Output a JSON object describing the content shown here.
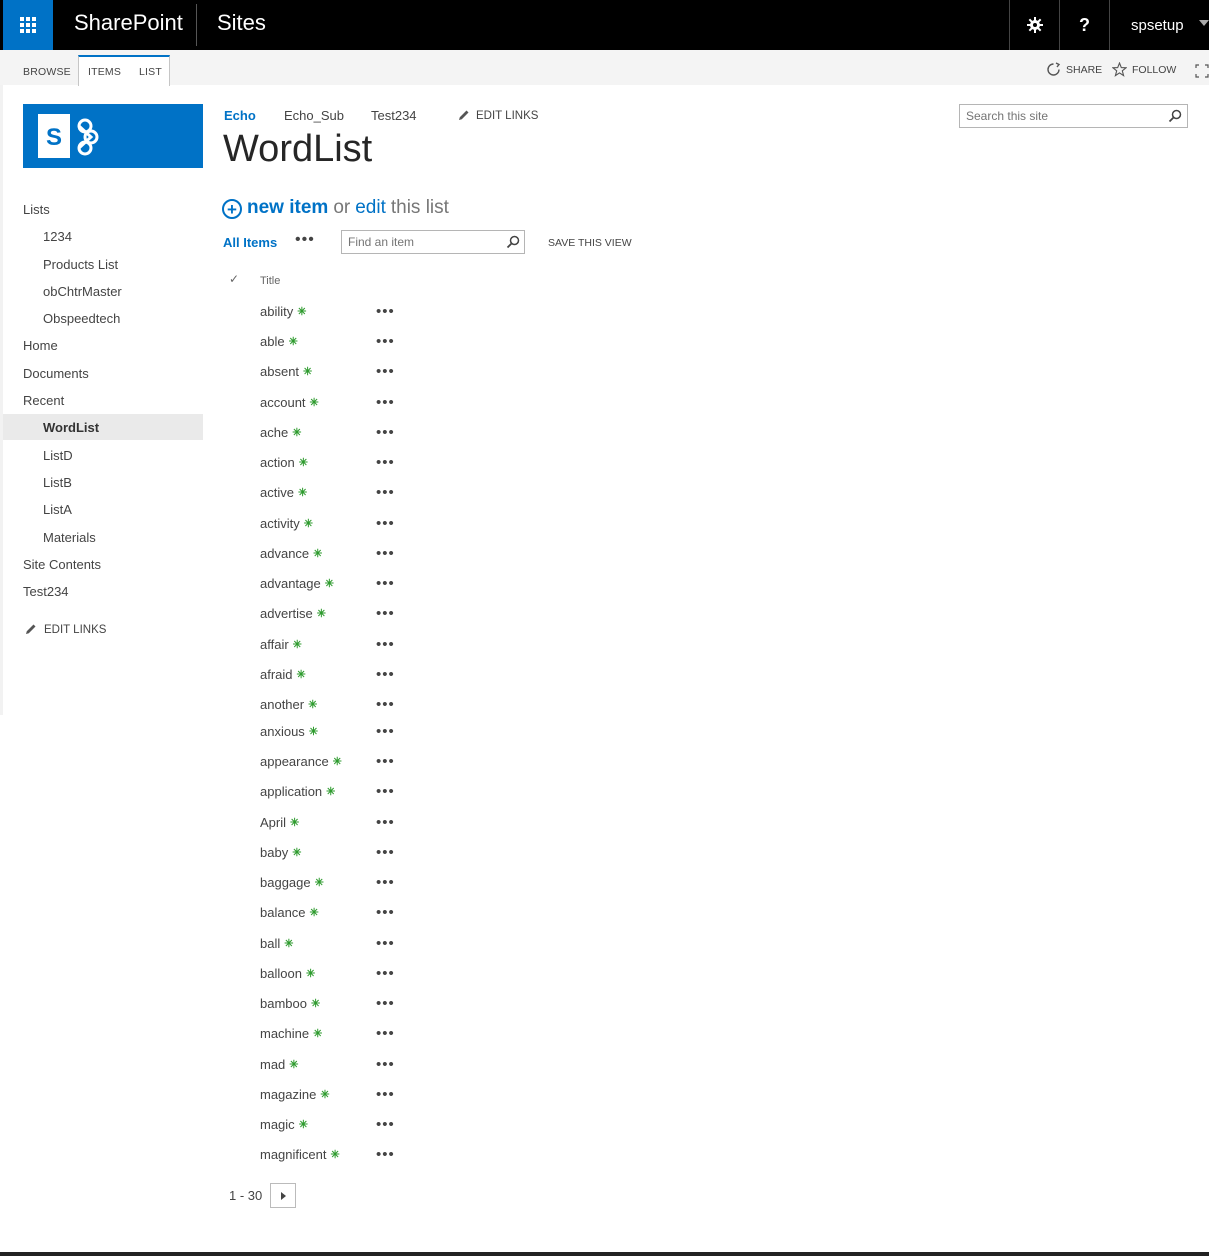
{
  "suite": {
    "brand": "SharePoint",
    "section": "Sites",
    "help": "?",
    "user": "spsetup"
  },
  "ribbon": {
    "tabs": [
      "BROWSE",
      "ITEMS",
      "LIST"
    ],
    "share": "SHARE",
    "follow": "FOLLOW"
  },
  "topnav": {
    "items": [
      "Echo",
      "Echo_Sub",
      "Test234"
    ],
    "edit_links": "EDIT LINKS"
  },
  "page": {
    "title": "WordList"
  },
  "search": {
    "site_placeholder": "Search this site",
    "find_placeholder": "Find an item"
  },
  "leftnav": {
    "items": [
      {
        "label": "Lists",
        "level": 1
      },
      {
        "label": "1234",
        "level": 2
      },
      {
        "label": "Products List",
        "level": 2
      },
      {
        "label": "obChtrMaster",
        "level": 2
      },
      {
        "label": "Obspeedtech",
        "level": 2
      },
      {
        "label": "Home",
        "level": 1
      },
      {
        "label": "Documents",
        "level": 1
      },
      {
        "label": "Recent",
        "level": 1
      },
      {
        "label": "WordList",
        "level": 2,
        "selected": true
      },
      {
        "label": "ListD",
        "level": 2
      },
      {
        "label": "ListB",
        "level": 2
      },
      {
        "label": "ListA",
        "level": 2
      },
      {
        "label": "Materials",
        "level": 2
      },
      {
        "label": "Site Contents",
        "level": 1
      },
      {
        "label": "Test234",
        "level": 1
      }
    ],
    "edit_links": "EDIT LINKS"
  },
  "actions": {
    "new_item": "new item",
    "or": "or",
    "edit": "edit",
    "this_list": "this list"
  },
  "view": {
    "current": "All Items",
    "more": "•••",
    "save": "SAVE THIS VIEW"
  },
  "list": {
    "check_mark": "✓",
    "column_title": "Title",
    "row_more": "•••",
    "new_icon": "✳",
    "rows": [
      "ability",
      "able",
      "absent",
      "account",
      "ache",
      "action",
      "active",
      "activity",
      "advance",
      "advantage",
      "advertise",
      "affair",
      "afraid",
      "another",
      "anxious",
      "appearance",
      "application",
      "April",
      "baby",
      "baggage",
      "balance",
      "ball",
      "balloon",
      "bamboo",
      "machine",
      "mad",
      "magazine",
      "magic",
      "magnificent"
    ]
  },
  "pager": {
    "range": "1 - 30"
  },
  "colors": {
    "accent": "#0072c6",
    "suite_bar": "#000000",
    "new_badge": "#2e9b2e"
  }
}
